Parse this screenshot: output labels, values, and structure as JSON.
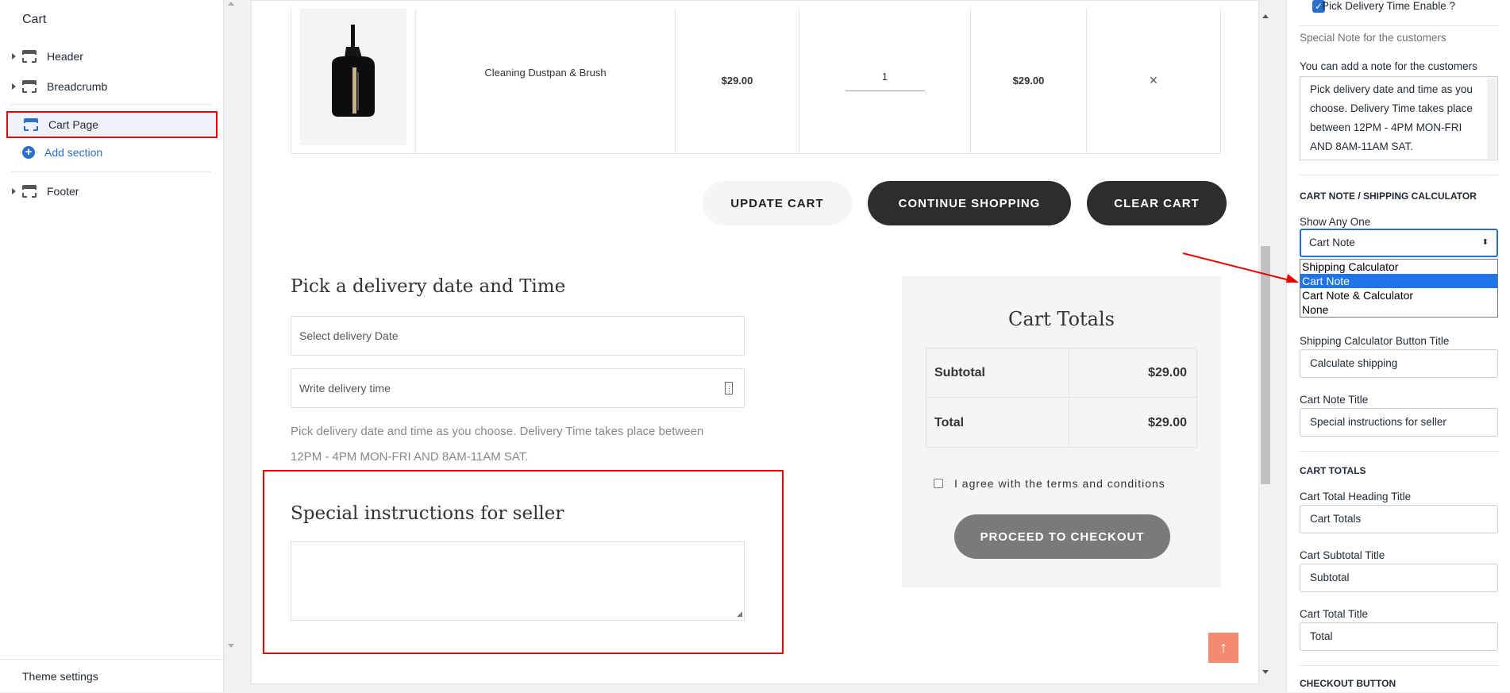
{
  "left_sidebar": {
    "title": "Cart",
    "items": [
      {
        "label": "Header"
      },
      {
        "label": "Breadcrumb"
      },
      {
        "label": "Cart Page"
      },
      {
        "label": "Footer"
      }
    ],
    "add_section": "Add section",
    "theme_settings": "Theme settings"
  },
  "cart": {
    "product_name": "Cleaning Dustpan & Brush",
    "price": "$29.00",
    "quantity": "1",
    "line_total": "$29.00",
    "remove_icon": "×",
    "update_cart": "UPDATE CART",
    "continue_shopping": "CONTINUE SHOPPING",
    "clear_cart": "CLEAR CART"
  },
  "delivery": {
    "heading": "Pick a delivery date and Time",
    "date_placeholder": "Select delivery Date",
    "time_placeholder": "Write delivery time",
    "note_line1": "Pick delivery date and time as you choose. Delivery Time takes place between",
    "note_line2": "12PM - 4PM MON-FRI AND 8AM-11AM SAT."
  },
  "special": {
    "heading": "Special instructions for seller"
  },
  "totals": {
    "heading": "Cart Totals",
    "subtotal_label": "Subtotal",
    "subtotal_value": "$29.00",
    "total_label": "Total",
    "total_value": "$29.00",
    "terms": "I agree with the terms and conditions",
    "checkout": "PROCEED TO CHECKOUT",
    "back_to_top_icon": "↑"
  },
  "right_sidebar": {
    "pick_delivery_label": "Pick Delivery Time Enable ?",
    "special_note_heading": "Special Note for the customers",
    "note_hint": "You can add a note for the customers",
    "note_value": "Pick delivery date and time as you choose. Delivery Time takes place between 12PM - 4PM MON-FRI AND 8AM-11AM SAT.",
    "cart_note_section": "CART NOTE / SHIPPING CALCULATOR",
    "show_any_one": "Show Any One",
    "select_value": "Cart Note",
    "options": [
      "Shipping Calculator",
      "Cart Note",
      "Cart Note & Calculator",
      "None"
    ],
    "shipping_btn_title_label": "Shipping Calculator Button Title",
    "shipping_btn_title_value": "Calculate shipping",
    "cart_note_title_label": "Cart Note Title",
    "cart_note_title_value": "Special instructions for seller",
    "cart_totals_section": "CART TOTALS",
    "heading_title_label": "Cart Total Heading Title",
    "heading_title_value": "Cart Totals",
    "subtotal_title_label": "Cart Subtotal Title",
    "subtotal_title_value": "Subtotal",
    "total_title_label": "Cart Total Title",
    "total_title_value": "Total",
    "checkout_button_section": "CHECKOUT BUTTON"
  },
  "colors": {
    "accent_blue": "#2c6ecb",
    "highlight_red": "#ee0000",
    "dark_button": "#2d2d2d",
    "back_to_top": "#f28b72"
  }
}
